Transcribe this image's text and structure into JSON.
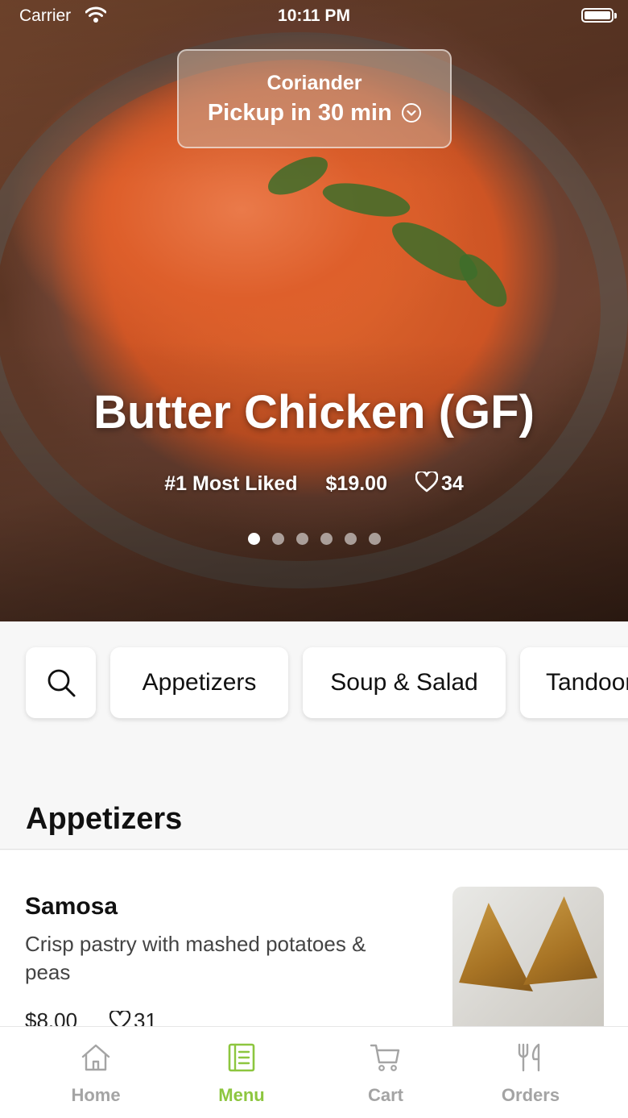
{
  "status_bar": {
    "carrier": "Carrier",
    "time": "10:11 PM"
  },
  "pickup": {
    "store": "Coriander",
    "eta": "Pickup in 30 min"
  },
  "hero": {
    "title": "Butter Chicken (GF)",
    "rank": "#1 Most Liked",
    "price": "$19.00",
    "likes": "34",
    "slide_count": 6,
    "active_slide": 1
  },
  "categories": {
    "search_icon": "search-icon",
    "items": [
      "Appetizers",
      "Soup & Salad",
      "Tandoori"
    ]
  },
  "section": {
    "title": "Appetizers"
  },
  "menu_items": [
    {
      "name": "Samosa",
      "description": "Crisp pastry with mashed potatoes & peas",
      "price": "$8.00",
      "likes": "31"
    }
  ],
  "tabs": [
    {
      "label": "Home",
      "icon": "home-icon",
      "active": false
    },
    {
      "label": "Menu",
      "icon": "menu-icon",
      "active": true
    },
    {
      "label": "Cart",
      "icon": "cart-icon",
      "active": false
    },
    {
      "label": "Orders",
      "icon": "orders-icon",
      "active": false
    }
  ],
  "colors": {
    "accent": "#8dc63f",
    "tab_inactive": "#a4a4a4"
  }
}
